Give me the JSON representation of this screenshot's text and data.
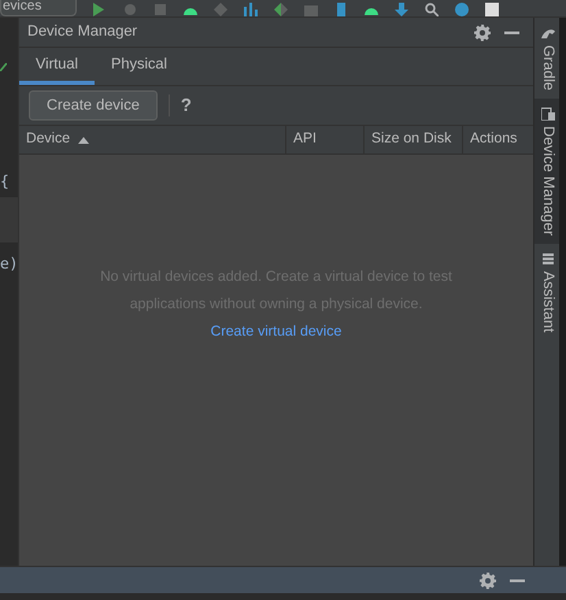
{
  "toolbar": {
    "config_dropdown": "evices"
  },
  "editor": {
    "fragments": [
      {
        "text": "{"
      },
      {
        "text": "e)"
      }
    ]
  },
  "panel": {
    "title": "Device Manager",
    "tabs": [
      {
        "label": "Virtual",
        "selected": true
      },
      {
        "label": "Physical",
        "selected": false
      }
    ],
    "create_button": "Create device",
    "help": "?",
    "table": {
      "columns": [
        {
          "label": "Device",
          "sorted": true
        },
        {
          "label": "API",
          "sorted": false
        },
        {
          "label": "Size on Disk",
          "sorted": false
        },
        {
          "label": "Actions",
          "sorted": false
        }
      ]
    },
    "empty_message": "No virtual devices added. Create a virtual device to test applications without owning a physical device.",
    "empty_link": "Create virtual device"
  },
  "right_sidebar": [
    {
      "label": "Gradle",
      "selected": false,
      "kind": "gradle"
    },
    {
      "label": "Device Manager",
      "selected": true,
      "kind": "device"
    },
    {
      "label": "Assistant",
      "selected": false,
      "kind": "assistant"
    }
  ]
}
